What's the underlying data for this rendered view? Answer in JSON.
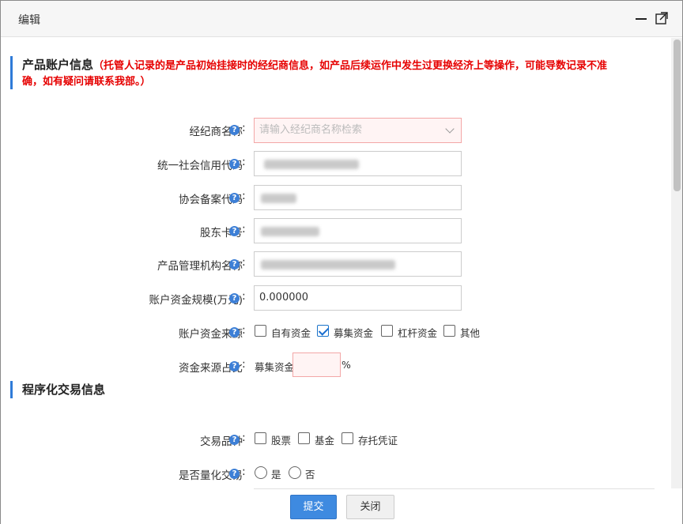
{
  "dialog": {
    "title": "编辑"
  },
  "section_product": {
    "heading": "产品账户信息",
    "note_line1": "（托管人记录的是产品初始挂接时的经纪商信息，如产品后续运作中发生过更换经济上等操作，可能导数记录不准",
    "note_line2": "确，如有疑问请联系我部。）"
  },
  "fields": {
    "broker_name": {
      "label": "经纪商名称",
      "placeholder": "请输入经纪商名称检索"
    },
    "credit_code": {
      "label": "统一社会信用代码",
      "value": ""
    },
    "association_code": {
      "label": "协会备案代码",
      "value": ""
    },
    "shareholder_card": {
      "label": "股东卡号",
      "value": ""
    },
    "manager_name": {
      "label": "产品管理机构名称",
      "value": ""
    },
    "fund_scale": {
      "label": "账户资金规模(万元)",
      "value": "0.000000"
    },
    "fund_source": {
      "label": "账户资金来源",
      "options": [
        {
          "label": "自有资金",
          "checked": false
        },
        {
          "label": "募集资金",
          "checked": true
        },
        {
          "label": "杠杆资金",
          "checked": false
        },
        {
          "label": "其他",
          "checked": false
        }
      ]
    },
    "fund_ratio": {
      "label": "资金来源占比",
      "prefix": "募集资金",
      "suffix": "%",
      "value": ""
    }
  },
  "section_program": {
    "heading": "程序化交易信息"
  },
  "program_fields": {
    "trade_type": {
      "label": "交易品种",
      "options": [
        {
          "label": "股票",
          "checked": false
        },
        {
          "label": "基金",
          "checked": false
        },
        {
          "label": "存托凭证",
          "checked": false
        }
      ]
    },
    "quant": {
      "label": "是否量化交易",
      "options": [
        {
          "label": "是",
          "selected": false
        },
        {
          "label": "否",
          "selected": false
        }
      ]
    }
  },
  "help_icon_glyph": "?",
  "colon": ":",
  "buttons": {
    "submit": "提交",
    "close": "关闭"
  },
  "colors": {
    "accent": "#3e8ae0",
    "warning_text": "#e60000",
    "required_border": "#f3a7a7"
  }
}
